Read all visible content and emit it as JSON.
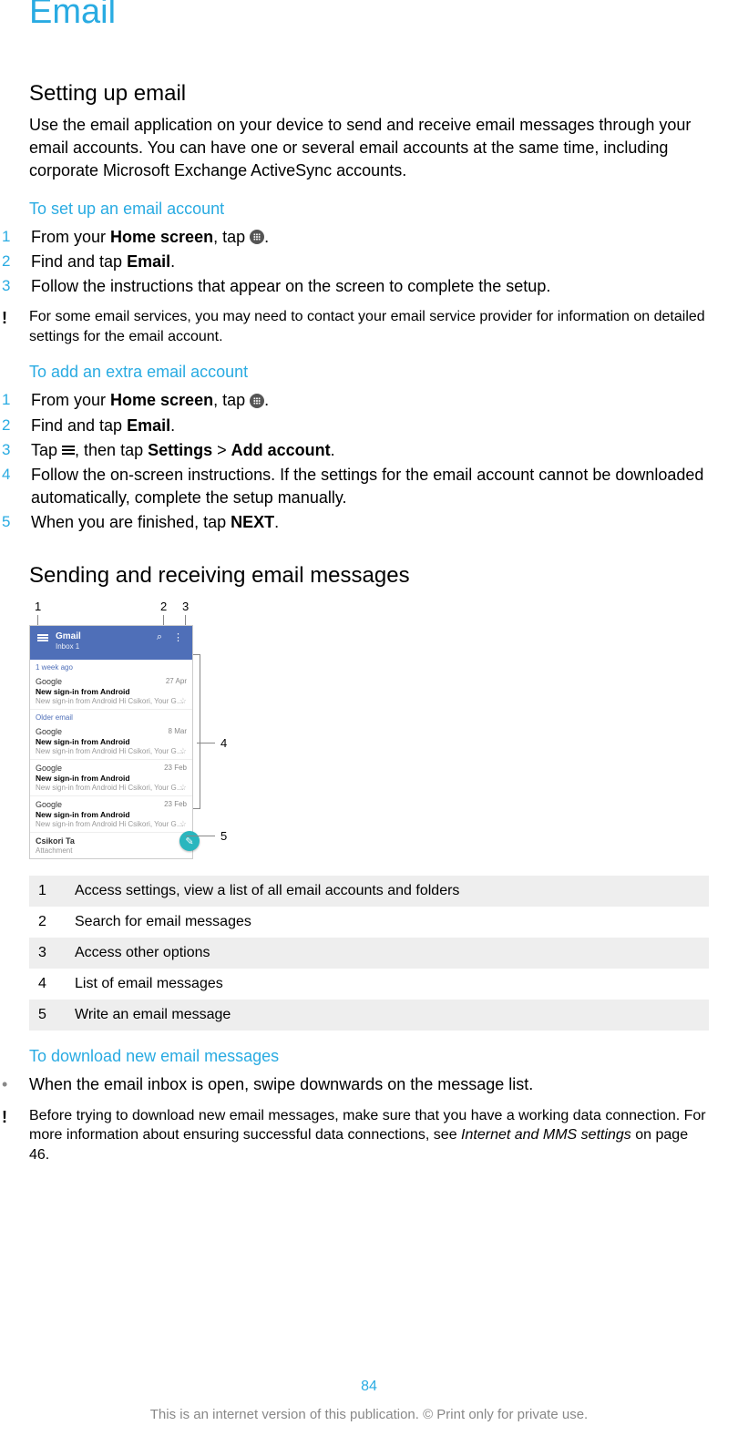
{
  "title": "Email",
  "section_setup": {
    "heading": "Setting up email",
    "intro": "Use the email application on your device to send and receive email messages through your email accounts. You can have one or several email accounts at the same time, including corporate Microsoft Exchange ActiveSync accounts.",
    "sub_setup": {
      "heading": "To set up an email account",
      "steps": {
        "s1a": "From your ",
        "s1b": "Home screen",
        "s1c": ", tap ",
        "s1d": ".",
        "s2a": "Find and tap ",
        "s2b": "Email",
        "s2c": ".",
        "s3": "Follow the instructions that appear on the screen to complete the setup."
      },
      "note": "For some email services, you may need to contact your email service provider for information on detailed settings for the email account."
    },
    "sub_add": {
      "heading": "To add an extra email account",
      "steps": {
        "s1a": "From your ",
        "s1b": "Home screen",
        "s1c": ", tap ",
        "s1d": ".",
        "s2a": "Find and tap ",
        "s2b": "Email",
        "s2c": ".",
        "s3a": "Tap ",
        "s3b": ", then tap ",
        "s3c": "Settings",
        "s3d": " > ",
        "s3e": "Add account",
        "s3f": ".",
        "s4": "Follow the on-screen instructions. If the settings for the email account cannot be downloaded automatically, complete the setup manually.",
        "s5a": "When you are finished, tap ",
        "s5b": "NEXT",
        "s5c": "."
      }
    }
  },
  "section_sendrecv": {
    "heading": "Sending and receiving email messages",
    "screenshot": {
      "app_title": "Gmail",
      "app_subtitle": "Inbox 1",
      "section1": "1 week ago",
      "section2": "Older email",
      "mails": [
        {
          "from": "Google",
          "date": "27 Apr",
          "subj": "New sign-in from Android",
          "prev": "New sign-in from Android Hi Csikori, Your Google A…"
        },
        {
          "from": "Google",
          "date": "8 Mar",
          "subj": "New sign-in from Android",
          "prev": "New sign-in from Android Hi Csikori, Your Google A…"
        },
        {
          "from": "Google",
          "date": "23 Feb",
          "subj": "New sign-in from Android",
          "prev": "New sign-in from Android Hi Csikori, Your Google A…"
        },
        {
          "from": "Google",
          "date": "23 Feb",
          "subj": "New sign-in from Android",
          "prev": "New sign-in from Android Hi Csikori, Your Google A…"
        }
      ],
      "footer_from": "Csikori Ta",
      "footer_sub": "Attachment",
      "callouts": {
        "c1": "1",
        "c2": "2",
        "c3": "3",
        "c4": "4",
        "c5": "5"
      }
    },
    "legend": [
      {
        "n": "1",
        "t": "Access settings, view a list of all email accounts and folders"
      },
      {
        "n": "2",
        "t": "Search for email messages"
      },
      {
        "n": "3",
        "t": "Access other options"
      },
      {
        "n": "4",
        "t": "List of email messages"
      },
      {
        "n": "5",
        "t": "Write an email message"
      }
    ],
    "sub_download": {
      "heading": "To download new email messages",
      "bullet": "When the email inbox is open, swipe downwards on the message list.",
      "note_a": "Before trying to download new email messages, make sure that you have a working data connection. For more information about ensuring successful data connections, see ",
      "note_b": "Internet and MMS settings",
      "note_c": " on page 46."
    }
  },
  "page_number": "84",
  "footer": "This is an internet version of this publication. © Print only for private use."
}
